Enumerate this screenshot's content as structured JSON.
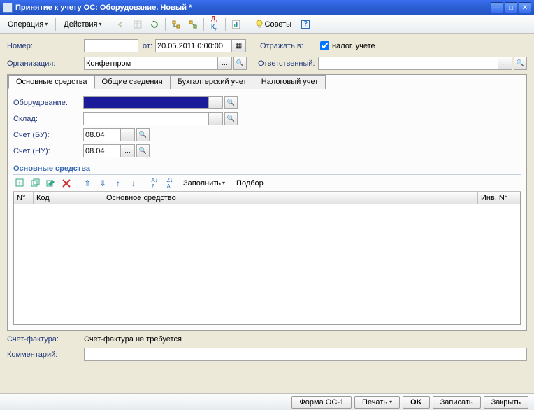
{
  "window": {
    "title": "Принятие к учету ОС: Оборудование. Новый *"
  },
  "menu": {
    "operation": "Операция",
    "actions": "Действия",
    "tips": "Советы"
  },
  "header": {
    "number_label": "Номер:",
    "from_label": "от:",
    "date_value": "20.05.2011 0:00:00",
    "reflect_label": "Отражать в:",
    "tax_checkbox": "налог. учете",
    "org_label": "Организация:",
    "org_value": "Конфетпром",
    "resp_label": "Ответственный:"
  },
  "tabs": [
    "Основные средства",
    "Общие сведения",
    "Бухгалтерский учет",
    "Налоговый учет"
  ],
  "tab1": {
    "equipment_label": "Оборудование:",
    "warehouse_label": "Склад:",
    "acct_bu_label": "Счет (БУ):",
    "acct_bu_value": "08.04",
    "acct_nu_label": "Счет (НУ):",
    "acct_nu_value": "08.04",
    "section_title": "Основные средства",
    "fill_btn": "Заполнить",
    "pick_btn": "Подбор",
    "cols": {
      "n": "N°",
      "kod": "Код",
      "os": "Основное средство",
      "inv": "Инв. N°"
    }
  },
  "footer": {
    "invoice_label": "Счет-фактура:",
    "invoice_value": "Счет-фактура не требуется",
    "comment_label": "Комментарий:"
  },
  "bottom": {
    "form": "Форма ОС-1",
    "print": "Печать",
    "ok": "OK",
    "save": "Записать",
    "close": "Закрыть"
  }
}
